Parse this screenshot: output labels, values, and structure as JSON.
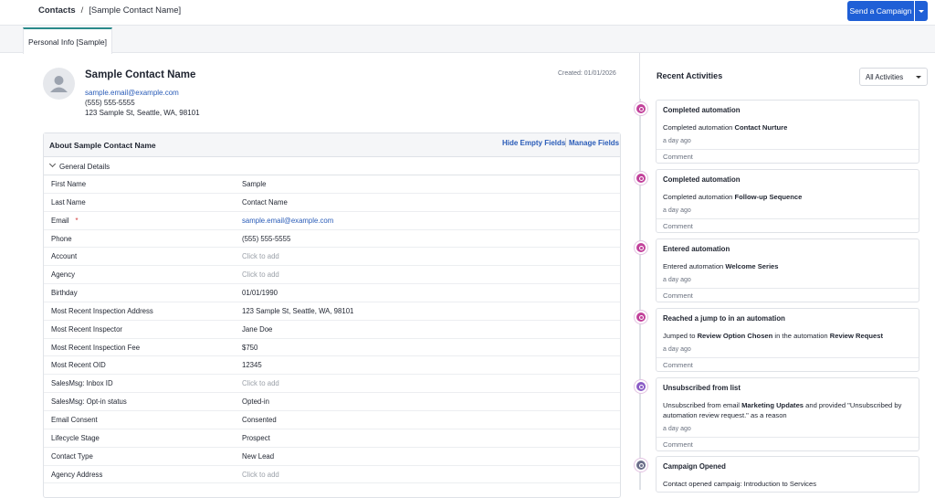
{
  "breadcrumb": {
    "root": "Contacts",
    "separator": "/",
    "current": "[Sample Contact Name]"
  },
  "header": {
    "send_campaign": "Send a Campaign"
  },
  "tabs": [
    {
      "label": "Personal Info [Sample]"
    }
  ],
  "contact": {
    "name": "Sample Contact Name",
    "email": "sample.email@example.com",
    "phone": "(555) 555-5555",
    "address": "123 Sample St, Seattle, WA, 98101",
    "created": "Created: 01/01/2026"
  },
  "about": {
    "title": "About Sample Contact Name",
    "hide_empty": "Hide Empty Fields",
    "manage": "Manage Fields",
    "group": "General Details",
    "fields": [
      {
        "label": "First Name",
        "value": "Sample"
      },
      {
        "label": "Last Name",
        "value": "Contact Name"
      },
      {
        "label": "Email",
        "required": "*",
        "value": "sample.email@example.com"
      },
      {
        "label": "Phone",
        "value": "(555) 555-5555"
      },
      {
        "label": "Account",
        "value": "Click to add"
      },
      {
        "label": "Agency",
        "value": "Click to add"
      },
      {
        "label": "Birthday",
        "value": "01/01/1990"
      },
      {
        "label": "Most Recent Inspection Address",
        "value": "123 Sample St, Seattle, WA, 98101"
      },
      {
        "label": "Most Recent Inspector",
        "value": "Jane Doe"
      },
      {
        "label": "Most Recent Inspection Fee",
        "value": "$750"
      },
      {
        "label": "Most Recent OID",
        "value": "12345"
      },
      {
        "label": "SalesMsg: Inbox ID",
        "value": "Click to add"
      },
      {
        "label": "SalesMsg: Opt-in status",
        "value": "Opted-in"
      },
      {
        "label": "Email Consent",
        "value": "Consented"
      },
      {
        "label": "Lifecycle Stage",
        "value": "Prospect"
      },
      {
        "label": "Contact Type",
        "value": "New Lead"
      },
      {
        "label": "Agency Address",
        "value": "Click to add"
      }
    ]
  },
  "activities": {
    "title": "Recent Activities",
    "filter": "All Activities",
    "comment_label": "Comment",
    "items": [
      {
        "title": "Completed automation",
        "text_pre": "Completed automation ",
        "text_bold": "Contact Nurture",
        "text_mid": "",
        "text_bold2": "",
        "text_post": "",
        "date": "a day ago",
        "icon": "gear-icon",
        "color": "#c2419b"
      },
      {
        "title": "Completed automation",
        "text_pre": "Completed automation ",
        "text_bold": "Follow-up Sequence",
        "text_mid": "",
        "text_bold2": "",
        "text_post": "",
        "date": "a day ago",
        "icon": "gear-icon",
        "color": "#c2419b"
      },
      {
        "title": "Entered automation",
        "text_pre": "Entered automation ",
        "text_bold": "Welcome Series",
        "text_mid": "",
        "text_bold2": "",
        "text_post": "",
        "date": "a day ago",
        "icon": "automation-icon",
        "color": "#c2419b"
      },
      {
        "title": "Reached a jump to in an automation",
        "text_pre": "Jumped to ",
        "text_bold": "Review Option Chosen",
        "text_mid": " in the automation ",
        "text_bold2": "Review Request",
        "text_post": "",
        "date": "a day ago",
        "icon": "jump-icon",
        "color": "#c2419b"
      },
      {
        "title": "Unsubscribed from list",
        "text_pre": "Unsubscribed from email ",
        "text_bold": "Marketing Updates",
        "text_mid": " and provided \"Unsubscribed by automation review request.\" as a reason",
        "text_bold2": "",
        "text_post": "",
        "date": "a day ago",
        "icon": "list-icon",
        "color": "#8b5cc6"
      },
      {
        "title": "Campaign Opened",
        "text_pre": "Contact opened campaig: Introduction to Services",
        "text_bold": "",
        "text_mid": "",
        "text_bold2": "",
        "text_post": "",
        "date": "",
        "icon": "envelope-icon",
        "color": "#6b6f8a"
      }
    ]
  }
}
